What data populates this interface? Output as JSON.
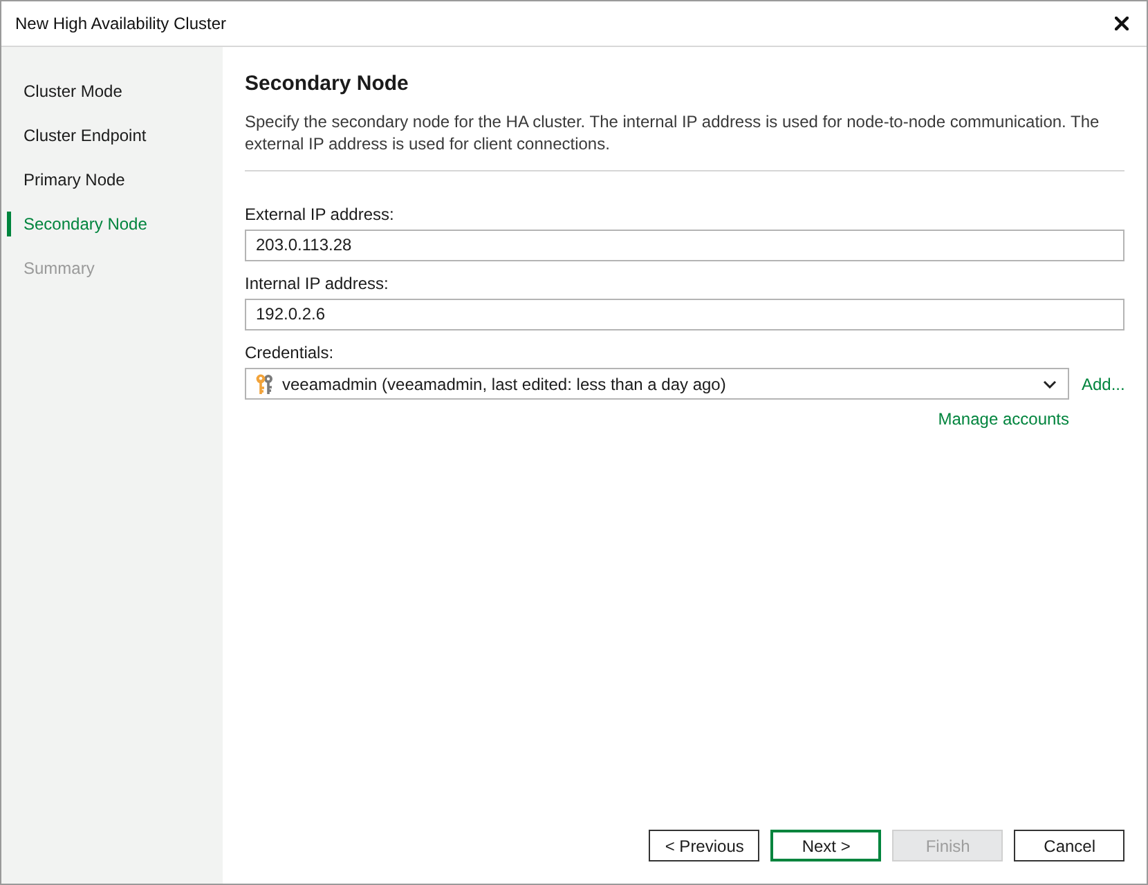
{
  "window": {
    "title": "New High Availability Cluster"
  },
  "sidebar": {
    "items": [
      {
        "label": "Cluster Mode",
        "selected": false,
        "disabled": false
      },
      {
        "label": "Cluster Endpoint",
        "selected": false,
        "disabled": false
      },
      {
        "label": "Primary Node",
        "selected": false,
        "disabled": false
      },
      {
        "label": "Secondary Node",
        "selected": true,
        "disabled": false
      },
      {
        "label": "Summary",
        "selected": false,
        "disabled": true
      }
    ]
  },
  "page": {
    "title": "Secondary Node",
    "description": "Specify the secondary node for the HA cluster. The internal IP address is used for node-to-node communication. The external IP address is used for client connections."
  },
  "fields": [
    {
      "label": "External IP address:",
      "value": "203.0.113.28"
    },
    {
      "label": "Internal IP address:",
      "value": "192.0.2.6"
    }
  ],
  "credentials": {
    "label": "Credentials:",
    "value": "veeamadmin (veeamadmin, last edited: less than a day ago)",
    "add_link": "Add...",
    "manage_link": "Manage accounts"
  },
  "buttons": [
    {
      "label": "< Previous",
      "default": false,
      "disabled": false
    },
    {
      "label": "Next >",
      "default": true,
      "disabled": false
    },
    {
      "label": "Finish",
      "default": false,
      "disabled": true
    },
    {
      "label": "Cancel",
      "default": false,
      "disabled": false
    }
  ]
}
